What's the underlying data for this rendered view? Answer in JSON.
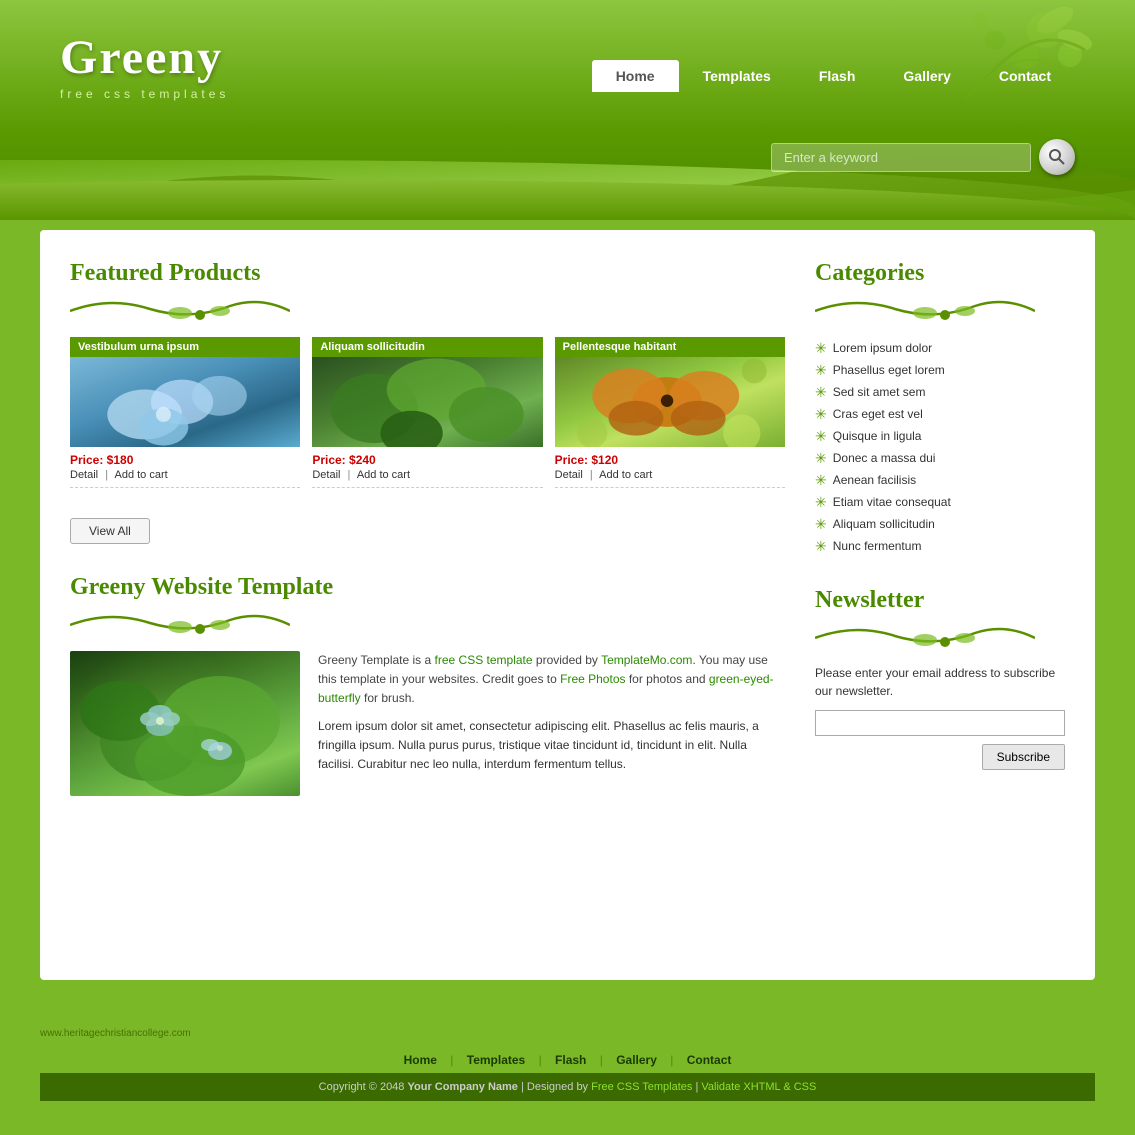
{
  "site": {
    "title": "Greeny",
    "tagline": "free css templates"
  },
  "nav": {
    "items": [
      {
        "label": "Home",
        "active": true
      },
      {
        "label": "Templates",
        "active": false
      },
      {
        "label": "Flash",
        "active": false
      },
      {
        "label": "Gallery",
        "active": false
      },
      {
        "label": "Contact",
        "active": false
      }
    ]
  },
  "search": {
    "placeholder": "Enter a keyword"
  },
  "featured": {
    "title": "Featured Products",
    "products": [
      {
        "label": "Vestibulum urna ipsum",
        "price": "Price: $180",
        "detail": "Detail",
        "add": "Add to cart"
      },
      {
        "label": "Aliquam sollicitudin",
        "price": "Price: $240",
        "detail": "Detail",
        "add": "Add to cart"
      },
      {
        "label": "Pellentesque habitant",
        "price": "Price: $120",
        "detail": "Detail",
        "add": "Add to cart"
      }
    ],
    "view_all": "View All"
  },
  "about": {
    "title": "Greeny Website Template",
    "text1": "Greeny Template is a free CSS template provided by TemplateMo.com. You may use this template in your websites. Credit goes to Free Photos for photos and green-eyed-butterfly for brush.",
    "text2": "Lorem ipsum dolor sit amet, consectetur adipiscing elit. Phasellus ac felis mauris, a fringilla ipsum. Nulla purus purus, tristique vitae tincidunt id, tincidunt in elit. Nulla facilisi. Curabitur nec leo nulla, interdum fermentum tellus."
  },
  "categories": {
    "title": "Categories",
    "items": [
      "Lorem ipsum dolor",
      "Phasellus eget lorem",
      "Sed sit amet sem",
      "Cras eget est vel",
      "Quisque in ligula",
      "Donec a massa dui",
      "Aenean facilisis",
      "Etiam vitae consequat",
      "Aliquam sollicitudin",
      "Nunc fermentum"
    ]
  },
  "newsletter": {
    "title": "Newsletter",
    "desc": "Please enter your email address to subscribe our newsletter.",
    "subscribe_label": "Subscribe"
  },
  "footer": {
    "nav": [
      "Home",
      "Templates",
      "Flash",
      "Gallery",
      "Contact"
    ],
    "left_text": "www.heritagechristiancollege.com",
    "copyright": "Copyright © 2048",
    "company": "Your Company Name",
    "designed": "Designed by",
    "template_link": "Free CSS Templates",
    "validate": "Validate XHTML & CSS"
  }
}
